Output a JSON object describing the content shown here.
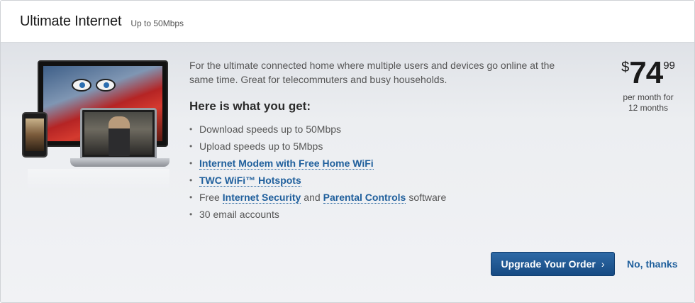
{
  "header": {
    "title": "Ultimate Internet",
    "subtitle": "Up to 50Mbps"
  },
  "description": "For the ultimate connected home where multiple users and devices go online at the same time. Great for telecommuters and busy households.",
  "features_title": "Here is what you get:",
  "features": {
    "f1": "Download speeds up to 50Mbps",
    "f2": "Upload speeds up to 5Mbps",
    "f3_link": "Internet Modem with Free Home WiFi",
    "f4_link": "TWC WiFi™ Hotspots",
    "f5_pre": "Free",
    "f5_link1": "Internet Security",
    "f5_mid": "and",
    "f5_link2": "Parental Controls",
    "f5_post": "software",
    "f6": "30 email accounts"
  },
  "price": {
    "currency": "$",
    "dollars": "74",
    "cents": "99",
    "term_line1": "per month for",
    "term_line2": "12 months"
  },
  "actions": {
    "upgrade_label": "Upgrade Your Order",
    "upgrade_icon": "chevron-right-icon",
    "no_thanks_label": "No, thanks"
  },
  "colors": {
    "accent": "#1f5f9c",
    "button": "#1f5a96"
  }
}
